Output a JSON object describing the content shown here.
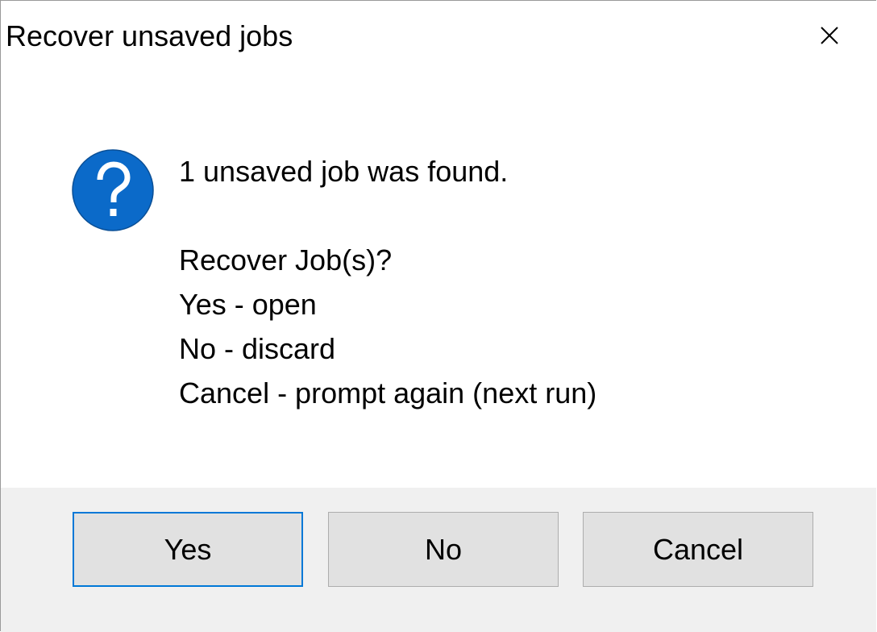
{
  "window": {
    "title": "Recover unsaved jobs",
    "close_icon": "close-icon"
  },
  "message": {
    "icon": "question-icon",
    "icon_color": "#0b6ac9",
    "headline": "1 unsaved job was found.",
    "question": "Recover Job(s)?",
    "options": [
      "Yes - open",
      "No - discard",
      "Cancel - prompt again (next run)"
    ]
  },
  "buttons": {
    "yes": "Yes",
    "no": "No",
    "cancel": "Cancel",
    "default": "yes"
  },
  "colors": {
    "footer_bg": "#f0f0f0",
    "button_bg": "#e1e1e1",
    "focus_border": "#0078d7"
  }
}
